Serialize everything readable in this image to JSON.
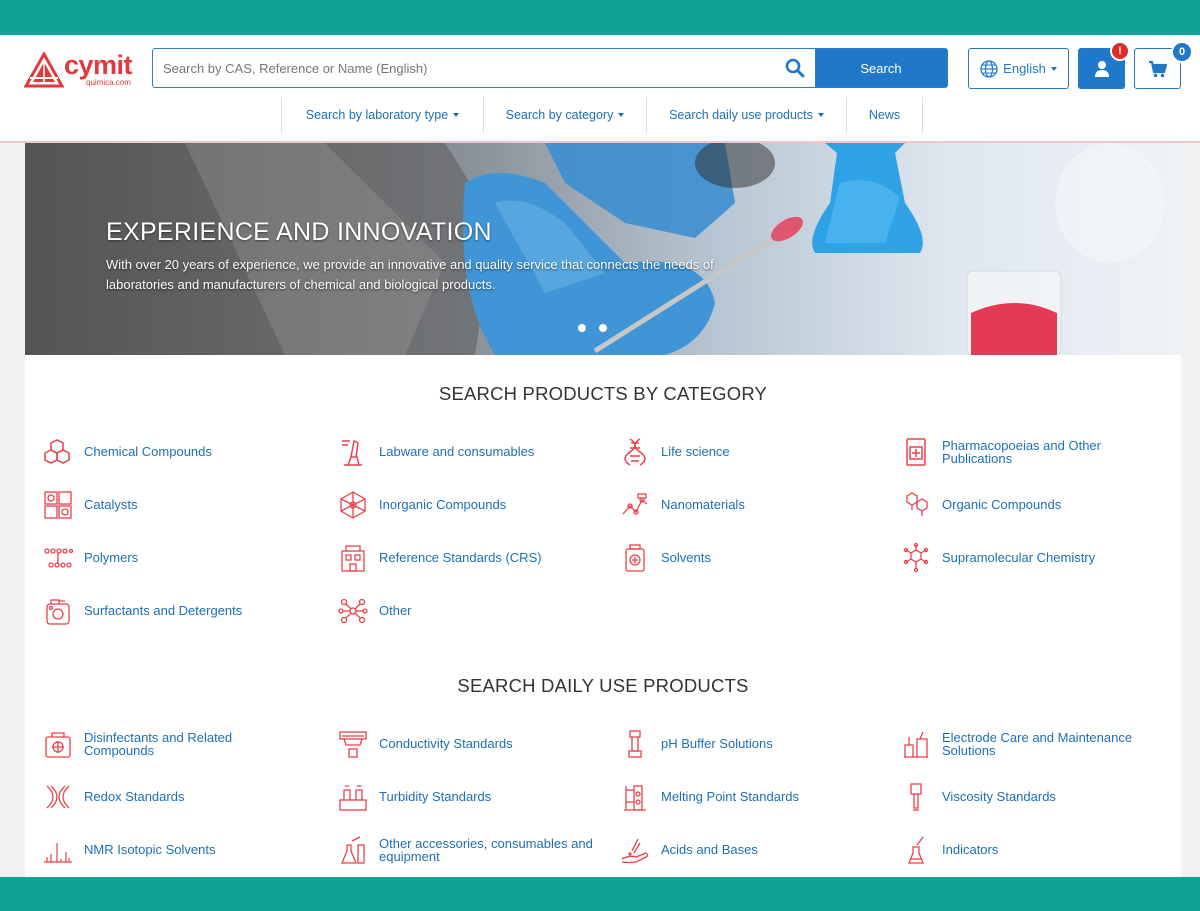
{
  "logo": {
    "name": "cymit",
    "sub": "quimica.com"
  },
  "search": {
    "placeholder": "Search by CAS, Reference or Name (English)",
    "button": "Search"
  },
  "language": {
    "label": "English"
  },
  "user": {
    "alert": "!"
  },
  "cart": {
    "count": "0"
  },
  "nav": [
    {
      "label": "Search by laboratory type"
    },
    {
      "label": "Search by category"
    },
    {
      "label": "Search daily use products"
    },
    {
      "label": "News"
    }
  ],
  "hero": {
    "title": "EXPERIENCE AND INNOVATION",
    "text": "With over 20 years of experience, we provide an innovative and quality service that connects the needs of laboratories and manufacturers of chemical and biological products."
  },
  "categories_section": {
    "title": "SEARCH PRODUCTS BY CATEGORY",
    "items": [
      {
        "label": "Chemical Compounds",
        "icon": "hexagons-icon"
      },
      {
        "label": "Labware and consumables",
        "icon": "microscope-icon"
      },
      {
        "label": "Life science",
        "icon": "dna-icon"
      },
      {
        "label": "Pharmacopoeias and Other Publications",
        "icon": "book-icon"
      },
      {
        "label": "Catalysts",
        "icon": "catalyst-grid-icon"
      },
      {
        "label": "Inorganic Compounds",
        "icon": "crystal-lattice-icon"
      },
      {
        "label": "Nanomaterials",
        "icon": "nanomaterial-icon"
      },
      {
        "label": "Organic Compounds",
        "icon": "molecule-icon"
      },
      {
        "label": "Polymers",
        "icon": "polymer-chain-icon"
      },
      {
        "label": "Reference Standards (CRS)",
        "icon": "building-icon"
      },
      {
        "label": "Solvents",
        "icon": "solvent-bottle-icon"
      },
      {
        "label": "Supramolecular Chemistry",
        "icon": "supramolecule-icon"
      },
      {
        "label": "Surfactants and Detergents",
        "icon": "detergent-icon"
      },
      {
        "label": "Other",
        "icon": "network-icon"
      }
    ]
  },
  "daily_section": {
    "title": "SEARCH DAILY USE PRODUCTS",
    "items": [
      {
        "label": "Disinfectants and Related Compounds",
        "icon": "disinfectant-icon"
      },
      {
        "label": "Conductivity Standards",
        "icon": "conductivity-icon"
      },
      {
        "label": "pH Buffer Solutions",
        "icon": "ph-probe-icon"
      },
      {
        "label": "Electrode Care and Maintenance Solutions",
        "icon": "electrode-icon"
      },
      {
        "label": "Redox Standards",
        "icon": "redox-icon"
      },
      {
        "label": "Turbidity Standards",
        "icon": "turbidity-icon"
      },
      {
        "label": "Melting Point Standards",
        "icon": "melting-point-icon"
      },
      {
        "label": "Viscosity Standards",
        "icon": "viscosity-icon"
      },
      {
        "label": "NMR Isotopic Solvents",
        "icon": "nmr-spectrum-icon"
      },
      {
        "label": "Other accessories, consumables and equipment",
        "icon": "flasks-icon"
      },
      {
        "label": "Acids and Bases",
        "icon": "acid-hand-icon"
      },
      {
        "label": "Indicators",
        "icon": "indicator-flask-icon"
      }
    ]
  },
  "colors": {
    "teal": "#0fa395",
    "brand_red": "#e03a3e",
    "primary_blue": "#1f78c8",
    "link_blue": "#1f6fb4",
    "icon_red": "#e8414b"
  }
}
